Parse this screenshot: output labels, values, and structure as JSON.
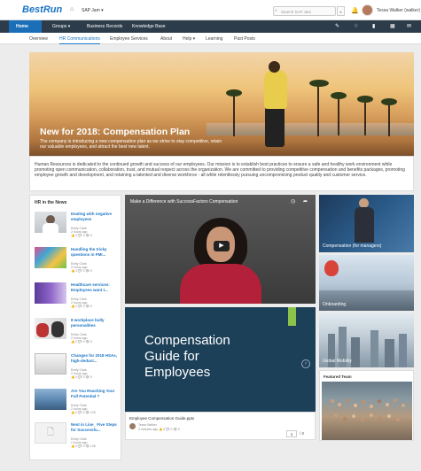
{
  "header": {
    "logo": "BestRun",
    "site": "SAP Jam",
    "search_placeholder": "Search SAP Jam",
    "user": "Tessa Walker (walker)"
  },
  "nav": {
    "items": [
      "Home",
      "Groups ▾",
      "Business Records",
      "Knowledge Base"
    ]
  },
  "subnav": {
    "items": [
      "Overview",
      "HR Communications",
      "Employee Services",
      "About",
      "Help ▾",
      "Learning",
      "Past Posts"
    ]
  },
  "hero": {
    "title": "New for 2018: Compensation Plan",
    "subtitle": "The company is introducing a new compensation plan as we strive to stay competitive, retain our valuable employees, and attract the best new talent."
  },
  "mission": "Human Resources is dedicated to the continued growth and success of our employees. Our mission is to establish best practices to ensure a safe and healthy work environment while promoting open communication, collaboration, trust, and mutual respect across the organization. We are committed to providing competitive compensation and benefits packages, promoting employee growth and development, and retaining a talented and diverse workforce - all while relentlessly pursuing uncompromising product quality and customer service.",
  "news": {
    "title": "HR in the News",
    "items": [
      {
        "headline": "Dealing with negative employees",
        "author": "Emily Clark",
        "time": "2 hours ago",
        "stats": "👍 0  💬 0  👁 0"
      },
      {
        "headline": "Handling the tricky questions in FMI...",
        "author": "Emily Clark",
        "time": "2 hours ago",
        "stats": "👍 0  💬 0  👁 0"
      },
      {
        "headline": "Healthcare services: Employees want t...",
        "author": "Emily Clark",
        "time": "2 hours ago",
        "stats": "👍 0  💬 0  👁 0"
      },
      {
        "headline": "8 workplace bully personalities",
        "author": "Emily Clark",
        "time": "2 hours ago",
        "stats": "👍 0  💬 0  👁 0"
      },
      {
        "headline": "Changes for 2018 HSAs, high-deduct...",
        "author": "Emily Clark",
        "time": "2 hours ago",
        "stats": "👍 0  💬 0  👁 0"
      },
      {
        "headline": "Are You Reaching Your Full Potential ?",
        "author": "Emily Clark",
        "time": "2 hours ago",
        "stats": "👍 0  💬 0  👁 129"
      },
      {
        "headline": "Next in Line_ Five Steps for Successfu...",
        "author": "Emily Clark",
        "time": "2 hours ago",
        "stats": "👍 0  💬 0  👁 126"
      }
    ]
  },
  "video": {
    "title": "Make a Difference with SuccessFactors Compensation"
  },
  "guide": {
    "title": "Compensation Guide for Employees",
    "file": "Employee Compensation Guide.pptx",
    "author": "Tessa Walker",
    "stats": "3 minutes ago  👍 0  💬 0  👁 0",
    "page": "1",
    "total": "/ 8"
  },
  "tiles": [
    {
      "label": "Compensation (for managers)"
    },
    {
      "label": "Onboarding"
    },
    {
      "label": "Global Mobility"
    }
  ],
  "featured": {
    "title": "Featured Team"
  }
}
